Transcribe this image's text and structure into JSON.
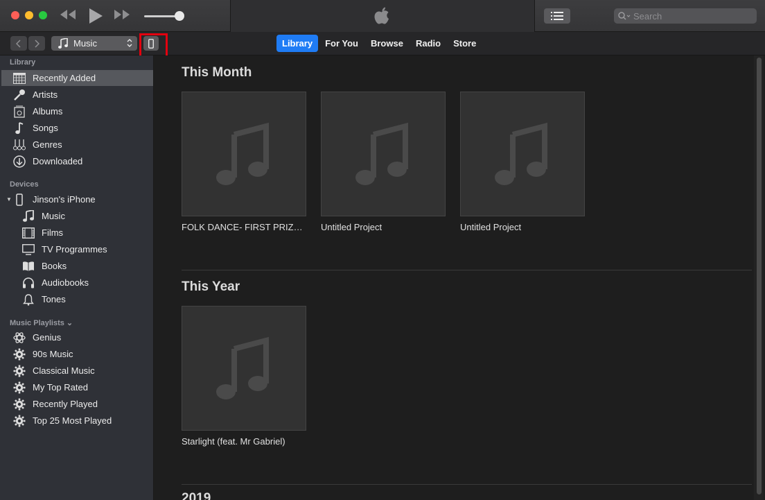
{
  "search": {
    "placeholder": "Search"
  },
  "media_select": {
    "label": "Music"
  },
  "tabs": [
    {
      "label": "Library",
      "active": true
    },
    {
      "label": "For You"
    },
    {
      "label": "Browse"
    },
    {
      "label": "Radio"
    },
    {
      "label": "Store"
    }
  ],
  "sidebar": {
    "library_header": "Library",
    "library": [
      {
        "label": "Recently Added",
        "icon": "grid-calendar-icon",
        "selected": true
      },
      {
        "label": "Artists",
        "icon": "microphone-icon"
      },
      {
        "label": "Albums",
        "icon": "album-icon"
      },
      {
        "label": "Songs",
        "icon": "note-icon"
      },
      {
        "label": "Genres",
        "icon": "guitar-icon"
      },
      {
        "label": "Downloaded",
        "icon": "download-circle-icon"
      }
    ],
    "devices_header": "Devices",
    "device_name": "Jinson's iPhone",
    "device_items": [
      {
        "label": "Music",
        "icon": "note-icon"
      },
      {
        "label": "Films",
        "icon": "film-icon"
      },
      {
        "label": "TV Programmes",
        "icon": "tv-icon"
      },
      {
        "label": "Books",
        "icon": "book-icon"
      },
      {
        "label": "Audiobooks",
        "icon": "headphones-icon"
      },
      {
        "label": "Tones",
        "icon": "bell-icon"
      }
    ],
    "playlists_header": "Music Playlists ⌄",
    "playlists": [
      {
        "label": "Genius",
        "icon": "atom-icon"
      },
      {
        "label": "90s Music",
        "icon": "gear-icon"
      },
      {
        "label": "Classical Music",
        "icon": "gear-icon"
      },
      {
        "label": "My Top Rated",
        "icon": "gear-icon"
      },
      {
        "label": "Recently Played",
        "icon": "gear-icon"
      },
      {
        "label": "Top 25 Most Played",
        "icon": "gear-icon"
      }
    ]
  },
  "main": {
    "this_month_title": "This Month",
    "this_month": [
      {
        "title": "FOLK DANCE- FIRST PRIZE…"
      },
      {
        "title": "Untitled Project"
      },
      {
        "title": "Untitled Project"
      }
    ],
    "this_year_title": "This Year",
    "this_year": [
      {
        "title": "Starlight (feat. Mr Gabriel)"
      }
    ],
    "next_section_title": "2019"
  },
  "colors": {
    "accent": "#1f7cf5",
    "highlight": "#e3000f"
  }
}
